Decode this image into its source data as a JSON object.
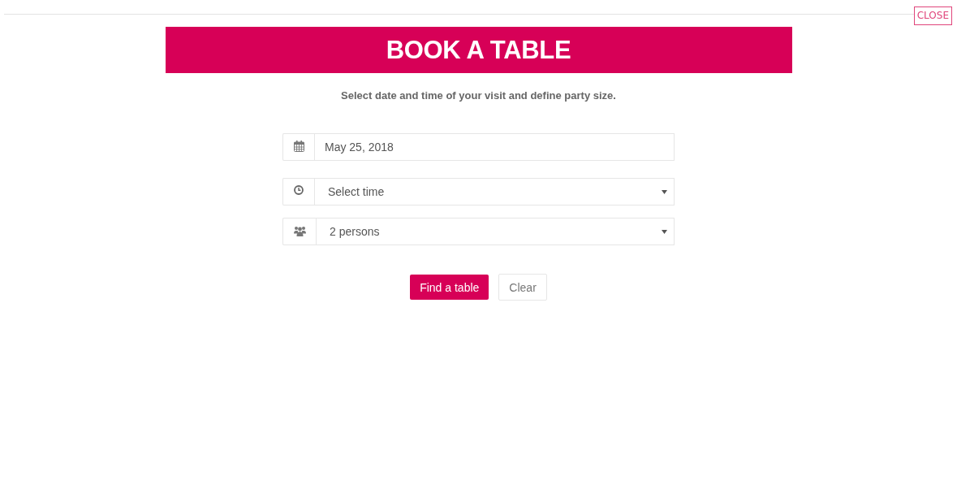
{
  "close_button": {
    "label": "CLOSE"
  },
  "header": {
    "title": "BOOK A TABLE"
  },
  "subtitle": "Select date and time of your visit and define party size.",
  "fields": [
    {
      "kind": "date",
      "value": "May 25, 2018"
    },
    {
      "kind": "time",
      "value": "Select time"
    },
    {
      "kind": "party",
      "value": "2 persons"
    }
  ],
  "buttons": [
    {
      "kind": "primary",
      "label": "Find a table"
    },
    {
      "kind": "secondary",
      "label": "Clear"
    }
  ]
}
